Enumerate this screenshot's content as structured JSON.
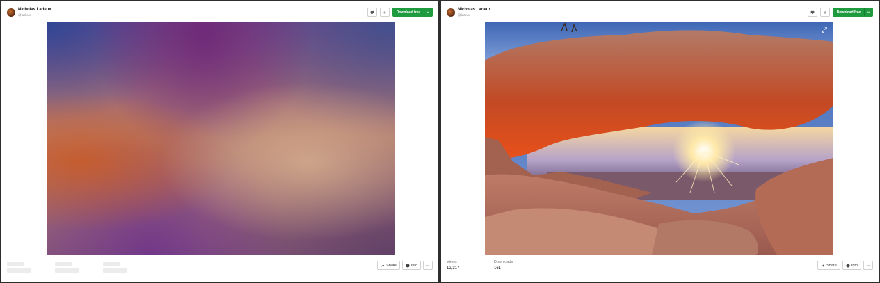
{
  "photo_pages": [
    {
      "state": "loading",
      "user": {
        "name": "Nicholas Ladeux",
        "handle": "@ladeux"
      },
      "header": {
        "download_label": "Download free"
      },
      "footer": {
        "share_label": "Share",
        "info_label": "Info"
      }
    },
    {
      "state": "loaded",
      "user": {
        "name": "Nicholas Ladeux",
        "handle": "@ladeux"
      },
      "header": {
        "download_label": "Download free"
      },
      "stats": {
        "views_label": "Views",
        "views_value": "12,317",
        "downloads_label": "Downloads",
        "downloads_value": "161"
      },
      "footer": {
        "share_label": "Share",
        "info_label": "Info"
      }
    }
  ],
  "icons": {
    "like": "heart-icon",
    "collect": "plus-icon",
    "caret": "chevron-down-icon",
    "expand": "expand-icon",
    "share": "share-arrow-icon",
    "info": "info-icon",
    "more": "more-icon"
  },
  "colors": {
    "download_green": "#1f9b3f"
  }
}
